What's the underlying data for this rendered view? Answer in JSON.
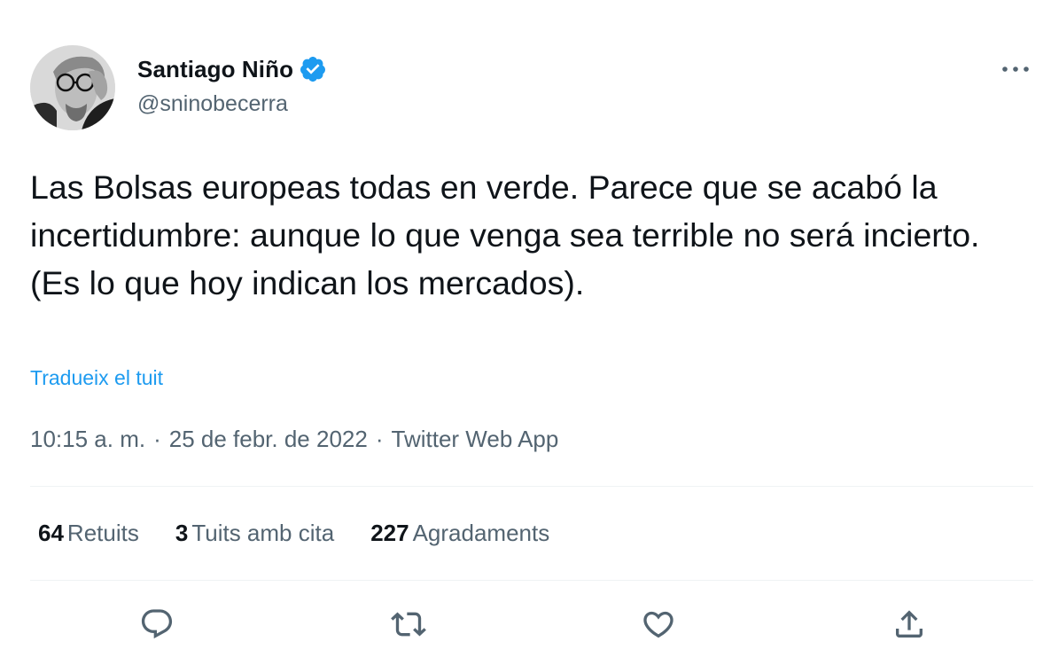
{
  "author": {
    "display_name": "Santiago Niño",
    "handle": "@sninobecerra",
    "verified": true
  },
  "tweet": {
    "text": "Las Bolsas europeas todas en verde. Parece que se acabó la incertidumbre: aunque lo que venga sea terrible no será incierto. (Es lo que hoy indican los mercados).",
    "translate_label": "Tradueix el tuit"
  },
  "meta": {
    "time": "10:15 a. m.",
    "date": "25 de febr. de 2022",
    "source": "Twitter Web App",
    "separator": "·"
  },
  "stats": {
    "retweets": {
      "count": "64",
      "label": "Retuits"
    },
    "quotes": {
      "count": "3",
      "label": "Tuits amb cita"
    },
    "likes": {
      "count": "227",
      "label": "Agradaments"
    }
  },
  "icons": {
    "reply": "reply-icon",
    "retweet": "retweet-icon",
    "like": "heart-icon",
    "share": "share-icon",
    "more": "more-icon",
    "verified": "verified-badge-icon"
  },
  "colors": {
    "accent": "#1d9bf0",
    "text": "#0f1419",
    "secondary": "#536471",
    "divider": "#eff3f4"
  }
}
